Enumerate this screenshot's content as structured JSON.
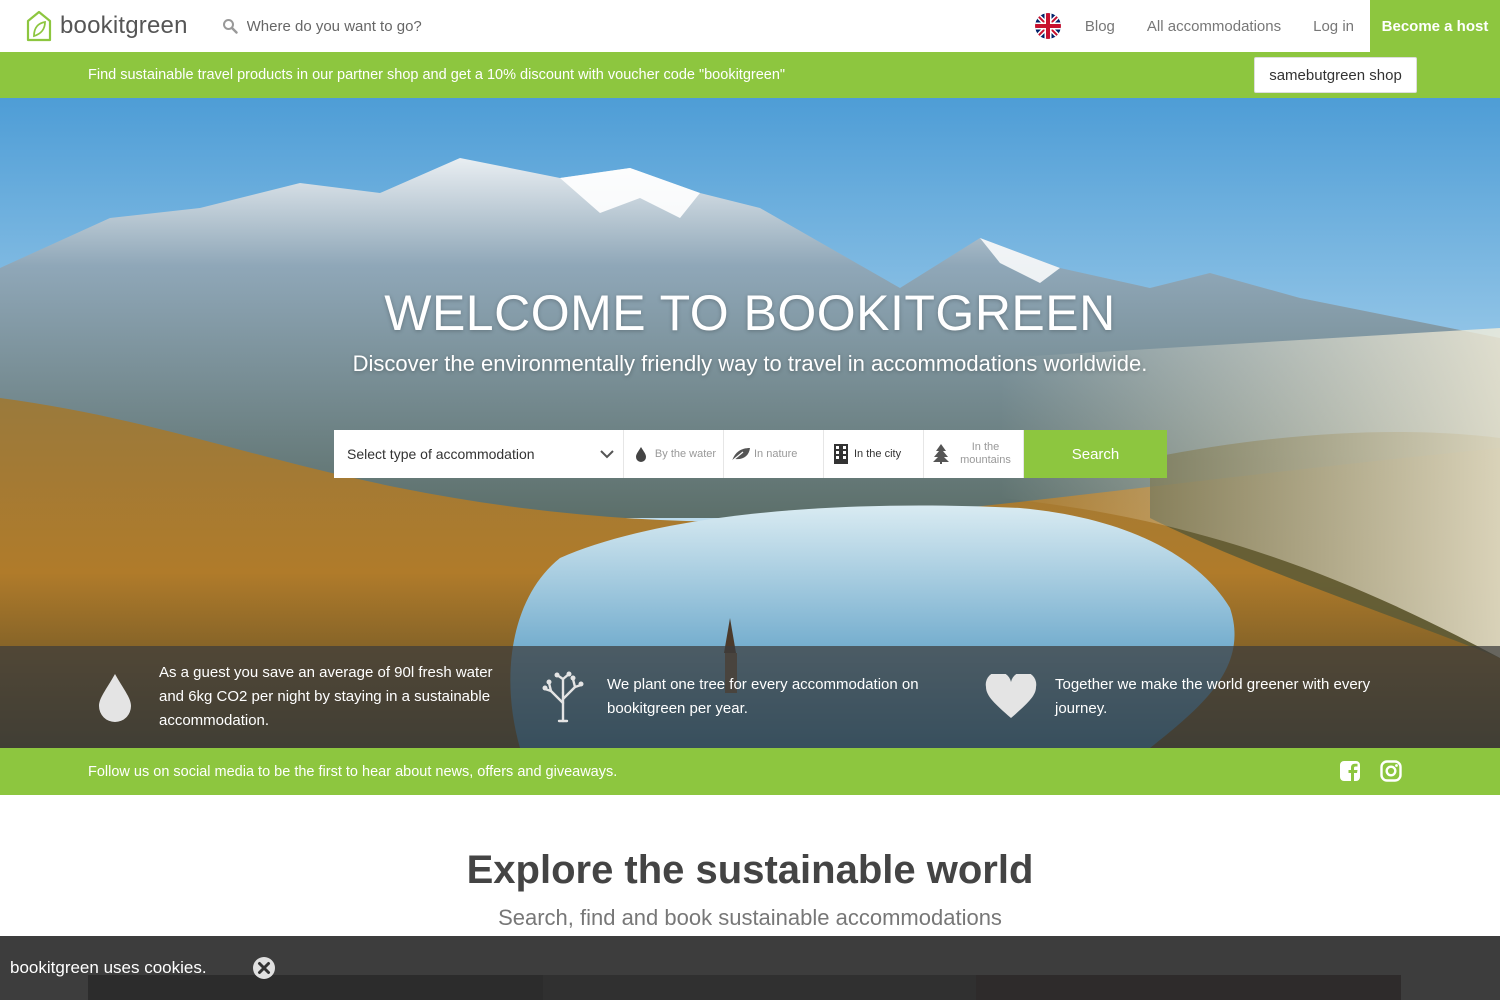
{
  "header": {
    "logo_text": "bookitgreen",
    "search_placeholder": "Where do you want to go?",
    "nav": [
      "Blog",
      "All accommodations",
      "Log in"
    ],
    "host_label": "Become a host"
  },
  "promo": {
    "text": "Find sustainable travel products in our partner shop and get a 10% discount with voucher code \"bookitgreen\"",
    "button": "samebutgreen shop"
  },
  "hero": {
    "title": "WELCOME TO BOOKITGREEN",
    "subtitle": "Discover the environmentally friendly way to travel in accommodations worldwide.",
    "select_label": "Select type of accommodation",
    "filters": [
      "By the water",
      "In nature",
      "In the city",
      "In the mountains"
    ],
    "search_label": "Search"
  },
  "facts": [
    "As a guest you save an average of 90l fresh water and 6kg CO2 per night by staying in a sustainable accommodation.",
    "We plant one tree for every accommodation on bookitgreen per year.",
    "Together we make the world greener with every journey."
  ],
  "social": {
    "text": "Follow us on social media to be the first to hear about news, offers and giveaways."
  },
  "explore": {
    "title": "Explore the sustainable world",
    "subtitle": "Search, find and book sustainable accommodations"
  },
  "cookie": {
    "text": "bookitgreen uses cookies."
  },
  "colors": {
    "brand_green": "#8dc63f",
    "fact_overlay": "#3c3c3c",
    "cookie_bar": "#282828"
  }
}
